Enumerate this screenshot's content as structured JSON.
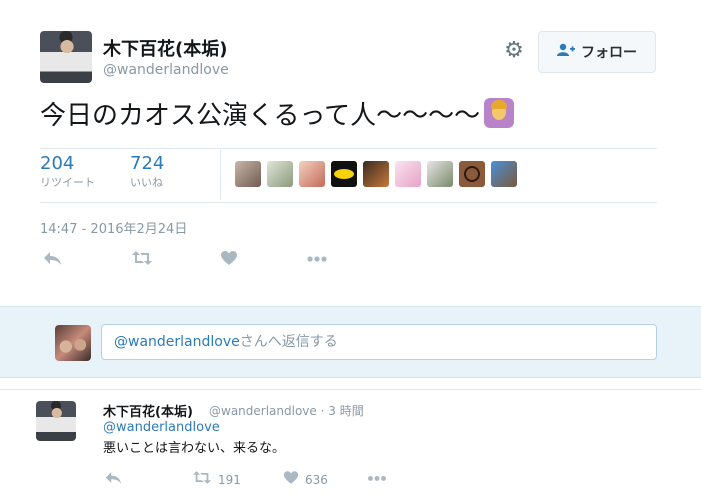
{
  "tweet": {
    "author_name": "木下百花(本垢)",
    "author_handle": "@wanderlandlove",
    "follow_label": "フォロー",
    "text": "今日のカオス公演くるって人〜〜〜〜",
    "emoji": "person-raising-hand-emoji",
    "retweet_count": "204",
    "retweet_label": "リツイート",
    "like_count": "724",
    "like_label": "いいね",
    "timestamp": "14:47 - 2016年2月24日"
  },
  "reply_box": {
    "mention": "@wanderlandlove",
    "placeholder_suffix": "さんへ返信する"
  },
  "reply_tweet": {
    "author_name": "木下百花(本垢)",
    "author_handle": "@wanderlandlove",
    "time_ago": "3 時間",
    "mention": "@wanderlandlove",
    "text": "悪いことは言わない、来るな。",
    "retweet_count": "191",
    "like_count": "636"
  },
  "icons": {
    "gear": "gear-icon",
    "follow": "add-user-icon",
    "reply": "reply-icon",
    "retweet": "retweet-icon",
    "like": "heart-icon",
    "more": "more-icon"
  },
  "colors": {
    "accent": "#2b7bb9",
    "muted": "#8899a6",
    "band": "#e8f2f9"
  }
}
